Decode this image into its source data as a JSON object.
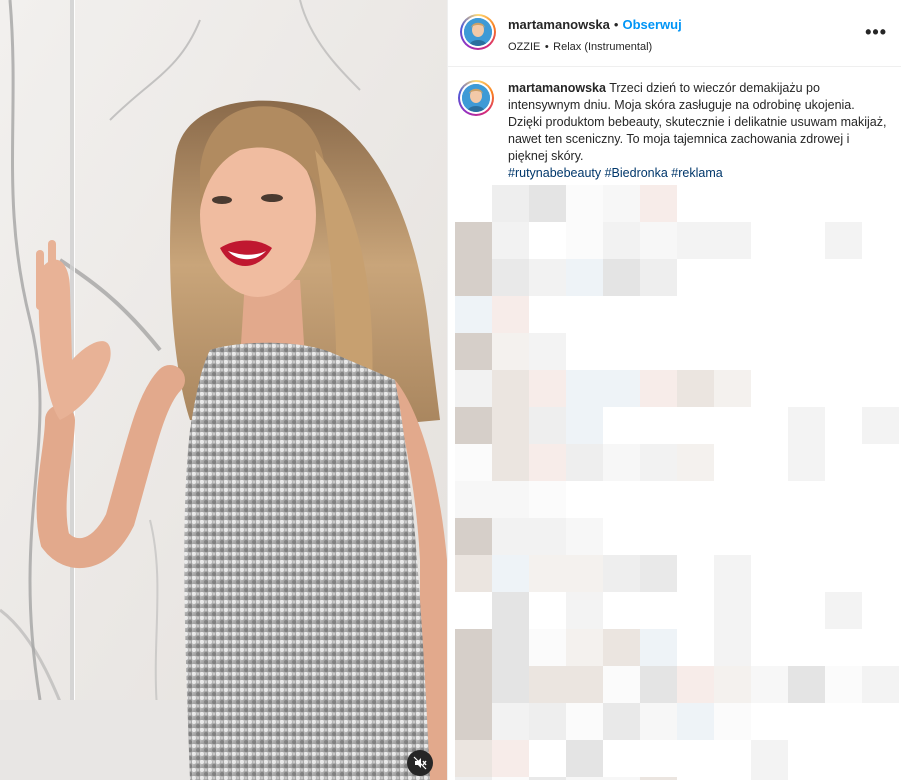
{
  "post": {
    "username": "martamanowska",
    "separator": "•",
    "follow_label": "Obserwuj",
    "music": {
      "artist": "OZZIE",
      "separator": "•",
      "track": "Relax (Instrumental)"
    },
    "more_label": "•••",
    "caption": {
      "username": "martamanowska",
      "text": "Trzeci dzień to wieczór demakijażu po intensywnym dniu. Moja skóra zasługuje na odrobinę ukojenia. Dzięki produktom bebeauty, skutecznie i delikatnie usuwam makijaż, nawet ten sceniczny. To moja tajemnica zachowania zdrowej i pięknej skóry.",
      "hashtags": "#rutynabebeauty #Biedronka #reklama"
    }
  },
  "media": {
    "mute_icon": "speaker-muted-icon"
  },
  "colors": {
    "link": "#0095f6",
    "hashtag": "#00376b",
    "text": "#262626",
    "border": "#efefef"
  }
}
